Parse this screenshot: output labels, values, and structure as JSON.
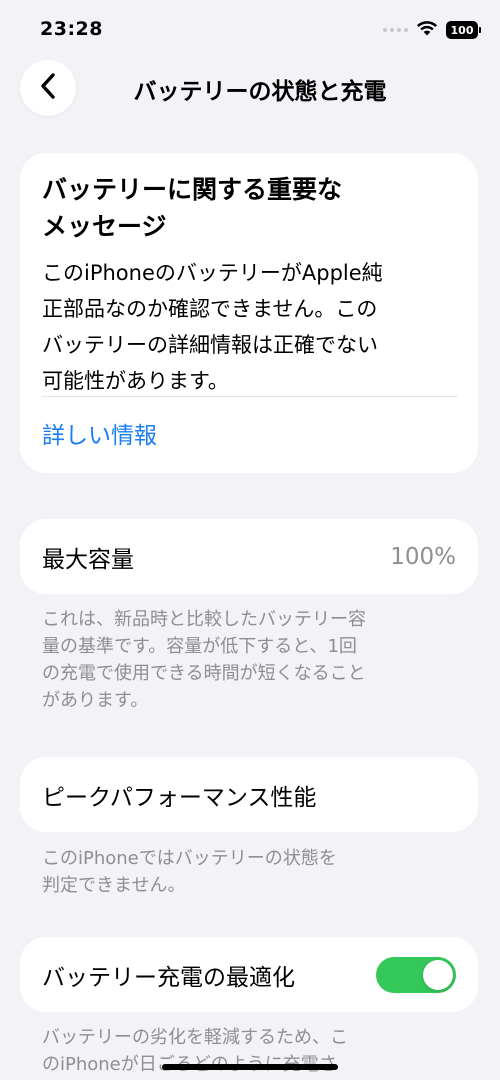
{
  "status_bar": {
    "time": "23:28",
    "battery_level": "100",
    "wifi_icon": "wifi-icon",
    "signal_icon": "cellular-signal-icon"
  },
  "nav": {
    "back_icon": "chevron-left-icon",
    "title": "バッテリーの状態と充電"
  },
  "message_card": {
    "title_line1": "バッテリーに関する重要な",
    "title_line2": "メッセージ",
    "body_lines": [
      "このiPhoneのバッテリーがApple純",
      "正部品なのか確認できません。この",
      "バッテリーの詳細情報は正確でない",
      "可能性があります。"
    ],
    "link": "詳しい情報"
  },
  "capacity": {
    "label": "最大容量",
    "value": "100%",
    "footnote_lines": [
      "これは、新品時と比較したバッテリー容",
      "量の基準です。容量が低下すると、1回",
      "の充電で使用できる時間が短くなること",
      "があります。"
    ]
  },
  "peak_performance": {
    "label": "ピークパフォーマンス性能",
    "footnote_lines": [
      "このiPhoneではバッテリーの状態を",
      "判定できません。"
    ]
  },
  "optimized_charging": {
    "label": "バッテリー充電の最適化",
    "enabled": true,
    "footnote_lines": [
      "バッテリーの劣化を軽減するため、こ",
      "のiPhoneが日ごろどのように充電さ"
    ]
  },
  "colors": {
    "accent": "#1a7ff6",
    "toggle_on": "#34c759",
    "background": "#f2f2f7",
    "secondary_text": "#8e8e93"
  }
}
